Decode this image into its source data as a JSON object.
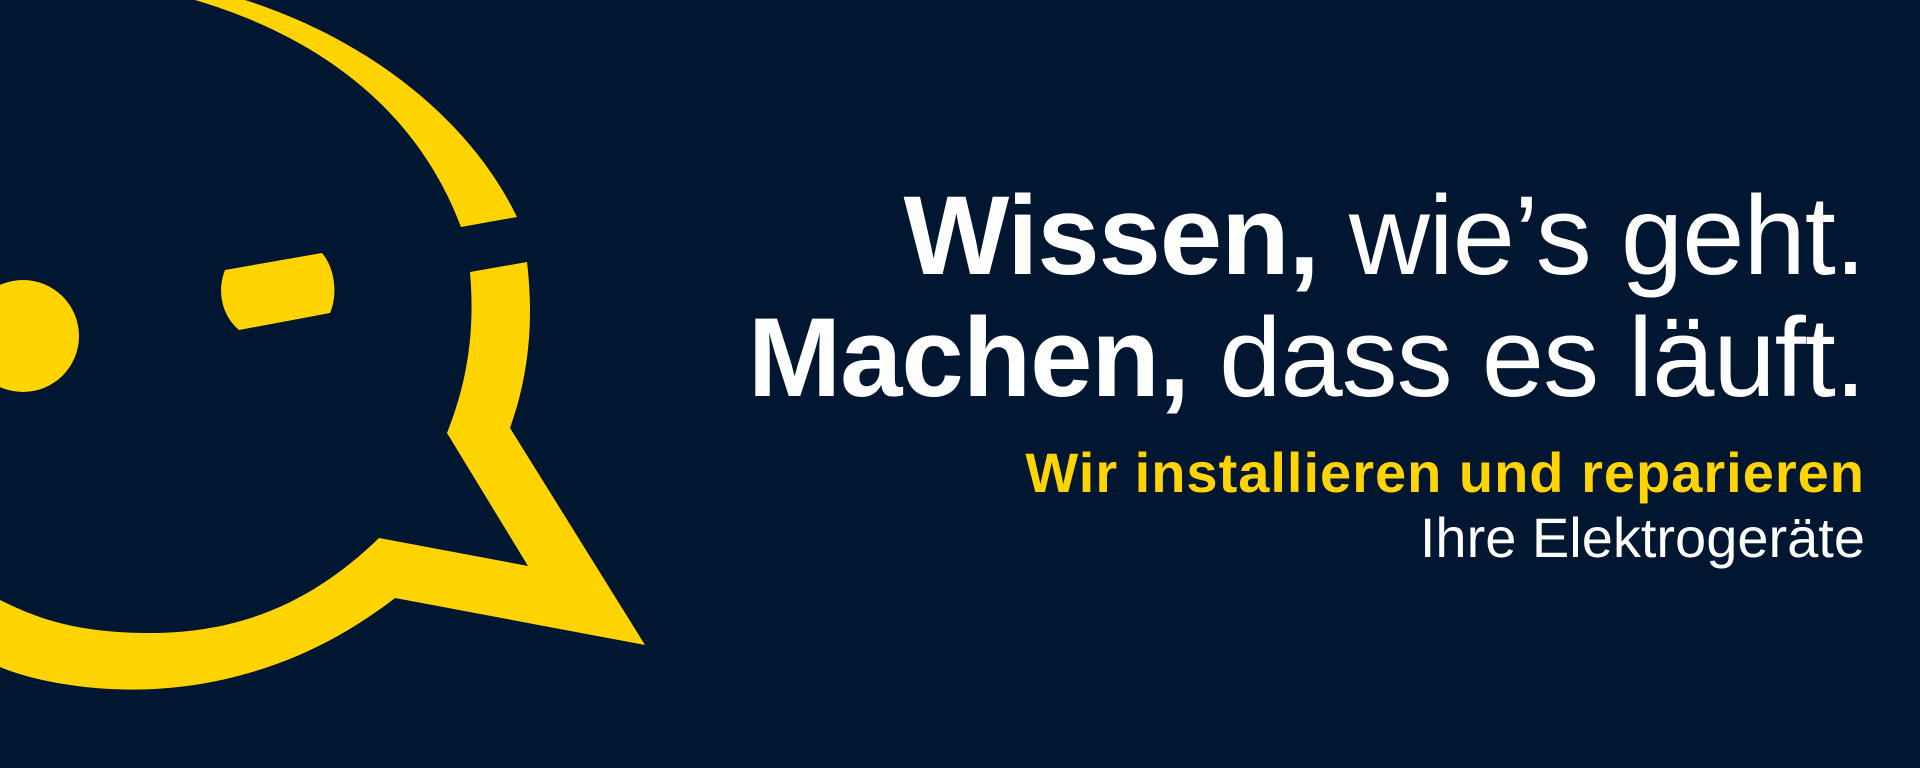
{
  "colors": {
    "background": "#011631",
    "accent": "#FFD400",
    "text": "#FFFFFF"
  },
  "logo": {
    "icon": "winking-speech-bubble-icon"
  },
  "headline": {
    "line1_bold": "Wissen,",
    "line1_thin": "wie’s geht.",
    "line2_bold": "Machen,",
    "line2_thin": "dass es läuft."
  },
  "subline": {
    "strong": "Wir installieren und reparieren",
    "thin": "Ihre Elektrogeräte"
  }
}
